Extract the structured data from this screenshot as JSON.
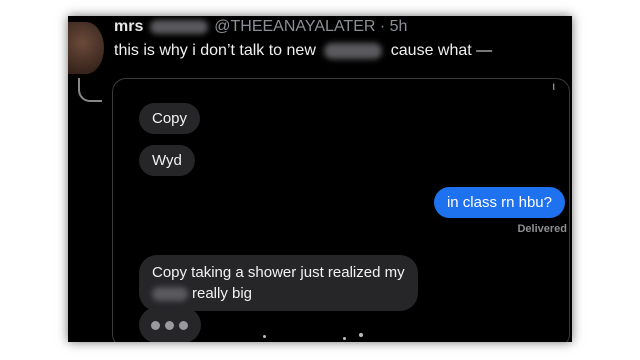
{
  "tweet": {
    "name": "mrs",
    "handle_time": "@THEEANAYALATER · 5h",
    "text_before": "this is why i don’t talk to new",
    "text_after": "cause what —"
  },
  "messages": [
    {
      "from": "them",
      "text": "Copy"
    },
    {
      "from": "them",
      "text": "Wyd"
    },
    {
      "from": "me",
      "text": "in class rn hbu?"
    },
    {
      "from": "them",
      "line1": "Copy taking a shower just realized my",
      "line2_after_blur": "really big"
    }
  ],
  "delivered_status": "Delivered",
  "colors": {
    "sent_bubble": "#1e72f0",
    "received_bubble": "#262629",
    "background": "#000000"
  }
}
